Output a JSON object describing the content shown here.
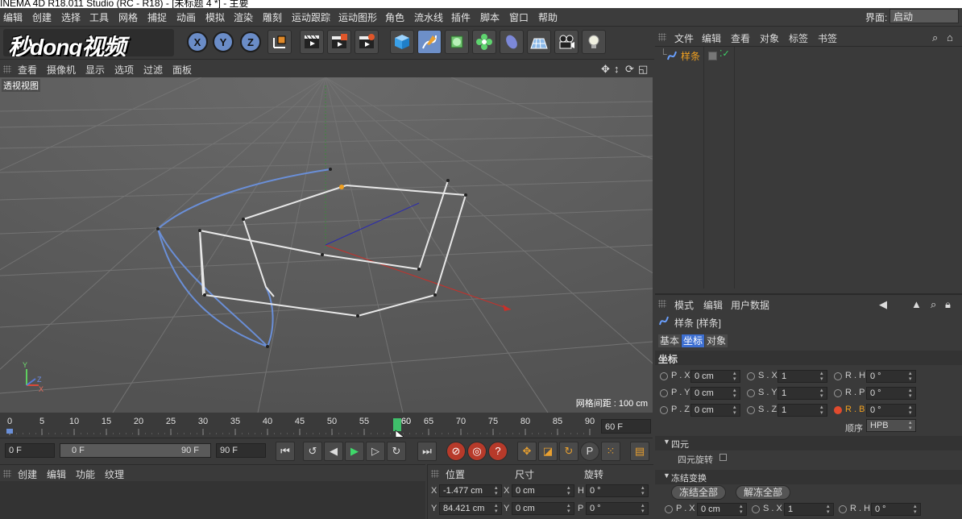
{
  "title": "INEMA 4D R18.011 Studio (RC - R18) - [未标题 4 *] - 主要",
  "menu": [
    "编辑",
    "创建",
    "选择",
    "工具",
    "网格",
    "捕捉",
    "动画",
    "模拟",
    "渲染",
    "雕刻",
    "运动跟踪",
    "运动图形",
    "角色",
    "流水线",
    "插件",
    "脚本",
    "窗口",
    "帮助"
  ],
  "layout": {
    "label": "界面:",
    "value": "启动"
  },
  "logo_text": "秒dong视频",
  "axis_buttons": [
    "X",
    "Y",
    "Z"
  ],
  "viewport": {
    "menu": [
      "查看",
      "摄像机",
      "显示",
      "选项",
      "过滤",
      "面板"
    ],
    "label": "透视视图",
    "grid_info": "网格间距 : 100 cm",
    "axis_labels": {
      "y": "Y",
      "z": "Z",
      "x": "X"
    }
  },
  "timeline": {
    "ticks": [
      "0",
      "5",
      "10",
      "15",
      "20",
      "25",
      "30",
      "35",
      "40",
      "45",
      "50",
      "55",
      "60",
      "65",
      "70",
      "75",
      "80",
      "85",
      "90"
    ],
    "current_frame": "60 F",
    "start": "0 F",
    "range_start": "0 F",
    "range_end": "90 F",
    "end": "90 F"
  },
  "material_panel": {
    "menu": [
      "创建",
      "编辑",
      "功能",
      "纹理"
    ]
  },
  "coord_panel": {
    "headers": [
      "位置",
      "尺寸",
      "旋转"
    ],
    "rows": [
      {
        "pos_axis": "X",
        "pos": "-1.477 cm",
        "size_axis": "X",
        "size": "0 cm",
        "rot_axis": "H",
        "rot": "0 °"
      },
      {
        "pos_axis": "Y",
        "pos": "84.421 cm",
        "size_axis": "Y",
        "size": "0 cm",
        "rot_axis": "P",
        "rot": "0 °"
      }
    ]
  },
  "object_manager": {
    "menu": [
      "文件",
      "编辑",
      "查看",
      "对象",
      "标签",
      "书签"
    ],
    "object_name": "样条"
  },
  "attr_manager": {
    "menu": [
      "模式",
      "编辑",
      "用户数据"
    ],
    "object_title": "样条 [样条]",
    "tabs": [
      "基本",
      "坐标",
      "对象"
    ],
    "section_title": "坐标",
    "coords": [
      {
        "p_label": "P . X",
        "p_val": "0 cm",
        "s_label": "S . X",
        "s_val": "1",
        "r_label": "R . H",
        "r_val": "0 °"
      },
      {
        "p_label": "P . Y",
        "p_val": "0 cm",
        "s_label": "S . Y",
        "s_val": "1",
        "r_label": "R . P",
        "r_val": "0 °"
      },
      {
        "p_label": "P . Z",
        "p_val": "0 cm",
        "s_label": "S . Z",
        "s_val": "1",
        "r_label": "R . B",
        "r_val": "0 °"
      }
    ],
    "order_label": "顺序",
    "order_value": "HPB",
    "quat_section": "四元",
    "quat_rotation": "四元旋转",
    "freeze_section": "冻结变换",
    "freeze_all": "冻结全部",
    "unfreeze_all": "解冻全部",
    "bottom_row": {
      "p_label": "P . X",
      "p_val": "0 cm",
      "s_label": "S . X",
      "s_val": "1",
      "r_label": "R . H",
      "r_val": "0 °"
    }
  },
  "colors": {
    "accent": "#3d6fd1",
    "spline_white": "#e8e8e8",
    "spline_blue": "#6a8fd8",
    "viewport_bg": "#5c5c5c"
  }
}
